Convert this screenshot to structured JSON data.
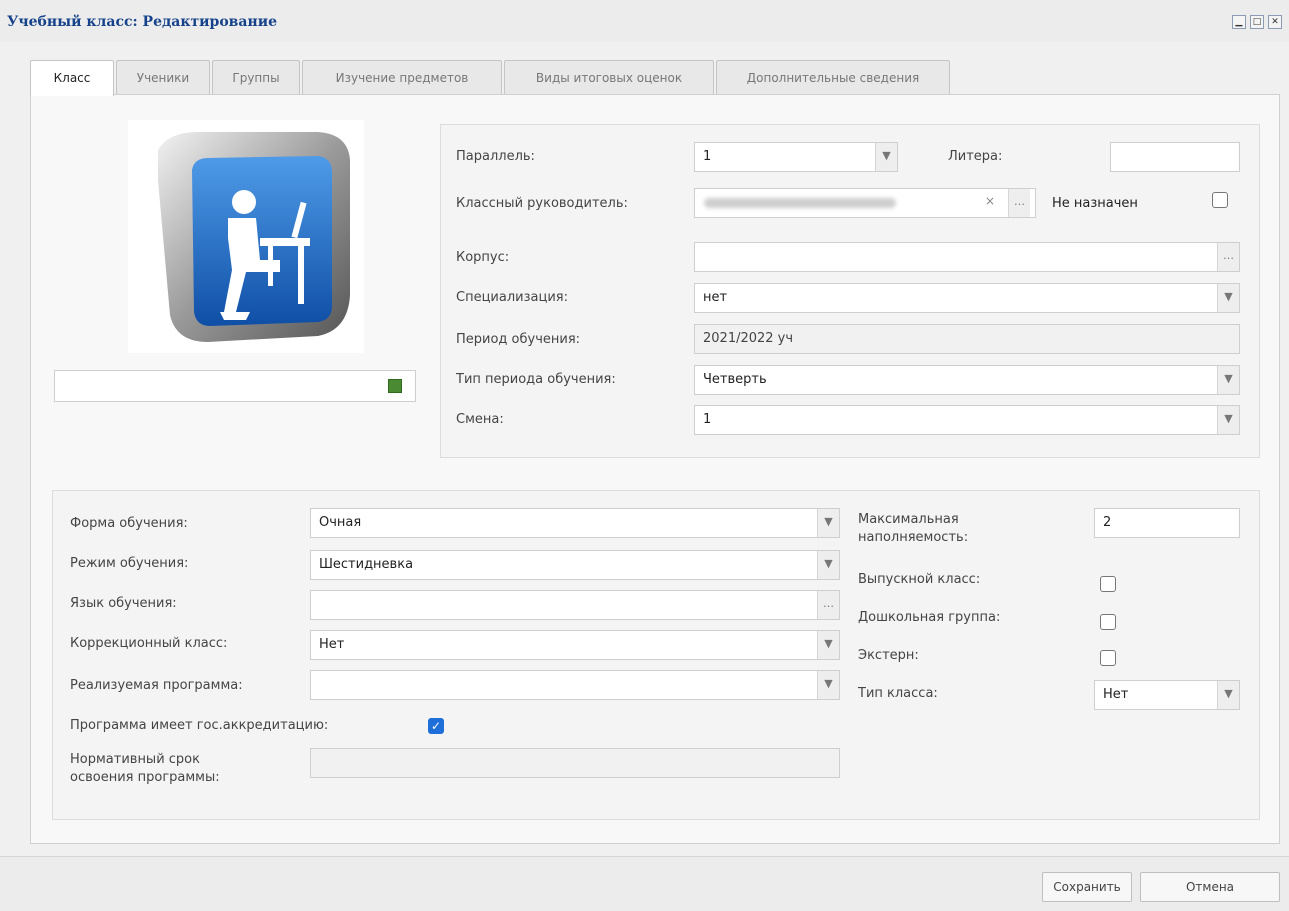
{
  "window": {
    "title": "Учебный класс: Редактирование"
  },
  "tabs": [
    {
      "label": "Класс"
    },
    {
      "label": "Ученики"
    },
    {
      "label": "Группы"
    },
    {
      "label": "Изучение предметов"
    },
    {
      "label": "Виды итоговых оценок"
    },
    {
      "label": "Дополнительные сведения"
    }
  ],
  "main": {
    "photo_field_value": "",
    "parallel": {
      "label": "Параллель:",
      "value": "1"
    },
    "litera": {
      "label": "Литера:",
      "value": ""
    },
    "class_teacher": {
      "label": "Классный руководитель:",
      "value": "",
      "clear_glyph": "×"
    },
    "not_assigned": {
      "label": "Не назначен",
      "checked": false
    },
    "building": {
      "label": "Корпус:",
      "value": ""
    },
    "specialization": {
      "label": "Специализация:",
      "value": "нет"
    },
    "study_period": {
      "label": "Период обучения:",
      "value": "2021/2022 уч"
    },
    "period_type": {
      "label": "Тип периода обучения:",
      "value": "Четверть"
    },
    "shift": {
      "label": "Смена:",
      "value": "1"
    }
  },
  "lower": {
    "study_form": {
      "label": "Форма обучения:",
      "value": "Очная"
    },
    "study_mode": {
      "label": "Режим обучения:",
      "value": "Шестидневка"
    },
    "language": {
      "label": "Язык обучения:",
      "value": ""
    },
    "correction_class": {
      "label": "Коррекционный класс:",
      "value": "Нет"
    },
    "program": {
      "label": "Реализуемая программа:",
      "value": ""
    },
    "accreditation": {
      "label": "Программа имеет гос.аккредитацию:",
      "checked": true
    },
    "normative_term": {
      "label_line1": "Нормативный срок",
      "label_line2": "освоения программы:",
      "value": ""
    },
    "max_capacity": {
      "label_line1": "Максимальная",
      "label_line2": "наполняемость:",
      "value": "2"
    },
    "graduation_class": {
      "label": "Выпускной класс:",
      "checked": false
    },
    "preschool_group": {
      "label": "Дошкольная группа:",
      "checked": false
    },
    "extern": {
      "label": "Экстерн:",
      "checked": false
    },
    "class_type": {
      "label": "Тип класса:",
      "value": "Нет"
    }
  },
  "buttons": {
    "save": "Сохранить",
    "cancel": "Отмена"
  },
  "colors": {
    "title": "#15428b",
    "checkbox_checked": "#1e6fd9",
    "icon_blue": "#1565c0"
  }
}
